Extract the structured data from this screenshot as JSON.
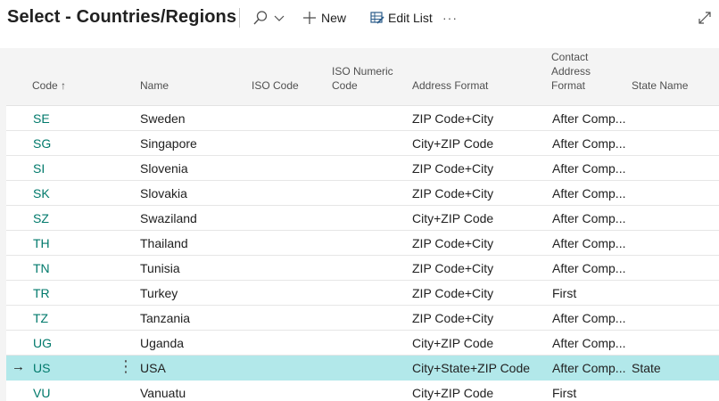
{
  "header": {
    "title": "Select - Countries/Regions",
    "new_label": "New",
    "edit_list_label": "Edit List",
    "more_label": "···"
  },
  "columns": {
    "code": "Code ↑",
    "name": "Name",
    "iso_code": "ISO Code",
    "iso_numeric_1": "ISO Numeric",
    "iso_numeric_2": "Code",
    "address_format": "Address Format",
    "contact_1": "Contact",
    "contact_2": "Address",
    "contact_3": "Format",
    "state_name": "State Name"
  },
  "rows": [
    {
      "code": "SE",
      "name": "Sweden",
      "iso_code": "",
      "iso_numeric": "",
      "address_format": "ZIP Code+City",
      "contact_address_format": "After Comp...",
      "state_name": ""
    },
    {
      "code": "SG",
      "name": "Singapore",
      "iso_code": "",
      "iso_numeric": "",
      "address_format": "City+ZIP Code",
      "contact_address_format": "After Comp...",
      "state_name": ""
    },
    {
      "code": "SI",
      "name": "Slovenia",
      "iso_code": "",
      "iso_numeric": "",
      "address_format": "ZIP Code+City",
      "contact_address_format": "After Comp...",
      "state_name": ""
    },
    {
      "code": "SK",
      "name": "Slovakia",
      "iso_code": "",
      "iso_numeric": "",
      "address_format": "ZIP Code+City",
      "contact_address_format": "After Comp...",
      "state_name": ""
    },
    {
      "code": "SZ",
      "name": "Swaziland",
      "iso_code": "",
      "iso_numeric": "",
      "address_format": "City+ZIP Code",
      "contact_address_format": "After Comp...",
      "state_name": ""
    },
    {
      "code": "TH",
      "name": "Thailand",
      "iso_code": "",
      "iso_numeric": "",
      "address_format": "ZIP Code+City",
      "contact_address_format": "After Comp...",
      "state_name": ""
    },
    {
      "code": "TN",
      "name": "Tunisia",
      "iso_code": "",
      "iso_numeric": "",
      "address_format": "ZIP Code+City",
      "contact_address_format": "After Comp...",
      "state_name": ""
    },
    {
      "code": "TR",
      "name": "Turkey",
      "iso_code": "",
      "iso_numeric": "",
      "address_format": "ZIP Code+City",
      "contact_address_format": "First",
      "state_name": ""
    },
    {
      "code": "TZ",
      "name": "Tanzania",
      "iso_code": "",
      "iso_numeric": "",
      "address_format": "ZIP Code+City",
      "contact_address_format": "After Comp...",
      "state_name": ""
    },
    {
      "code": "UG",
      "name": "Uganda",
      "iso_code": "",
      "iso_numeric": "",
      "address_format": "City+ZIP Code",
      "contact_address_format": "After Comp...",
      "state_name": ""
    },
    {
      "code": "US",
      "name": "USA",
      "iso_code": "",
      "iso_numeric": "",
      "address_format": "City+State+ZIP Code",
      "contact_address_format": "After Comp...",
      "state_name": "State",
      "selected": true
    },
    {
      "code": "VU",
      "name": "Vanuatu",
      "iso_code": "",
      "iso_numeric": "",
      "address_format": "City+ZIP Code",
      "contact_address_format": "First",
      "state_name": ""
    }
  ],
  "selection": {
    "row_arrow": "→",
    "row_menu": "⋮"
  },
  "icons": {
    "search": "search-icon",
    "chevron": "chevron-down-icon",
    "new": "plus-icon",
    "edit_list": "edit-list-icon",
    "expand": "expand-icon"
  },
  "colors": {
    "accent": "#00796b",
    "selected_row": "#b2e8ea"
  }
}
